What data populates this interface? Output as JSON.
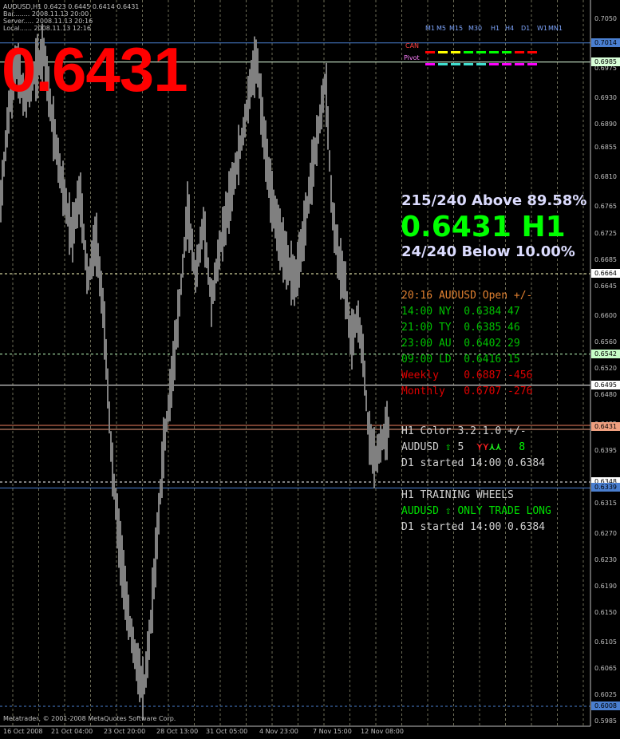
{
  "symbol_header": {
    "line1": "AUDUSD,H1  0.6423 0.6445 0.6414 0.6431",
    "line2": "Bar........ 2008.11.13 20:00",
    "line3": "Server..... 2008.11.13 20:16",
    "line4": "Local...... 2008.11.13 12:16"
  },
  "big_price": "0.6431",
  "stats": {
    "above": "215/240 Above 89.58%",
    "current": "0.6431 H1",
    "below": "24/240 Below 10.00%"
  },
  "timeframes": {
    "labels": [
      "M1",
      "M5",
      "M15",
      "M30",
      "H1",
      "H4",
      "D1",
      "W1",
      "MN1"
    ],
    "can_label": "CAN",
    "pivot_label": "Pivot",
    "can_colors": [
      "#ff0000",
      "#ffff00",
      "#ffff00",
      "#00ff00",
      "#00ff00",
      "#00ff00",
      "#00ff00",
      "#ff0000",
      "#ff0000"
    ],
    "pivot_colors": [
      "#ff00ff",
      "#40e0d0",
      "#40e0d0",
      "#40e0d0",
      "#40e0d0",
      "#ff00ff",
      "#ff00ff",
      "#ff00ff",
      "#ff00ff"
    ]
  },
  "sessions": {
    "title": "20:16 AUDUSD Open +/-",
    "rows": [
      {
        "text": "14:00 NY  0.6384 47",
        "color": "#00c000"
      },
      {
        "text": "21:00 TY  0.6385 46",
        "color": "#00c000"
      },
      {
        "text": "23:00 AU  0.6402 29",
        "color": "#00c000"
      },
      {
        "text": "09:00 LD  0.6416 15",
        "color": "#00c000"
      },
      {
        "text": "Weekly    0.6887 -456",
        "color": "#e00000"
      },
      {
        "text": "Monthly   0.6707 -276",
        "color": "#e00000"
      }
    ]
  },
  "h1_color": {
    "title": "H1 Color   3.2.1.0  +/-",
    "symbol": "AUDUSD",
    "up_arrow": "⇧",
    "count": "5",
    "arrows_red": "⋎⋎",
    "arrows_green": "⋏⋏",
    "count2": "8",
    "started": "D1 started 14:00 0.6384"
  },
  "training": {
    "title": "H1 TRAINING WHEELS",
    "line": "AUDUSD ⇧ ONLY TRADE LONG",
    "started": "D1 started 14:00 0.6384"
  },
  "price_axis": [
    "0.7050",
    "0.7014",
    "0.6985",
    "0.6975",
    "0.6930",
    "0.6890",
    "0.6855",
    "0.6810",
    "0.6765",
    "0.6725",
    "0.6685",
    "0.6664",
    "0.6645",
    "0.6600",
    "0.6560",
    "0.6542",
    "0.6520",
    "0.6495",
    "0.6480",
    "0.6435",
    "0.6431",
    "0.6395",
    "0.6348",
    "0.6339",
    "0.6315",
    "0.6270",
    "0.6230",
    "0.6190",
    "0.6150",
    "0.6105",
    "0.6065",
    "0.6025",
    "0.6008",
    "0.5985"
  ],
  "price_tags": [
    {
      "value": "0.7014",
      "bg": "#4a7fd0",
      "fg": "#000"
    },
    {
      "value": "0.6985",
      "bg": "#d8ffd8",
      "fg": "#000"
    },
    {
      "value": "0.6664",
      "bg": "#ffffff",
      "fg": "#000"
    },
    {
      "value": "0.6542",
      "bg": "#c8ffc8",
      "fg": "#000"
    },
    {
      "value": "0.6495",
      "bg": "#ffffff",
      "fg": "#000"
    },
    {
      "value": "0.6431",
      "bg": "#f0a080",
      "fg": "#000"
    },
    {
      "value": "0.6348",
      "bg": "#ffffff",
      "fg": "#000"
    },
    {
      "value": "0.6339",
      "bg": "#4a7fd0",
      "fg": "#000"
    },
    {
      "value": "0.6008",
      "bg": "#4a7fd0",
      "fg": "#000"
    }
  ],
  "time_axis": [
    "16 Oct 2008",
    "21 Oct 04:00",
    "23 Oct 20:00",
    "28 Oct 13:00",
    "31 Oct 05:00",
    "4 Nov 23:00",
    "7 Nov 15:00",
    "12 Nov 08:00"
  ],
  "copyright": "Metatrader, © 2001-2008 MetaQuotes Software Corp.",
  "colors": {
    "background": "#000000",
    "candles": "#808080",
    "grid": "#c8c8a0"
  }
}
